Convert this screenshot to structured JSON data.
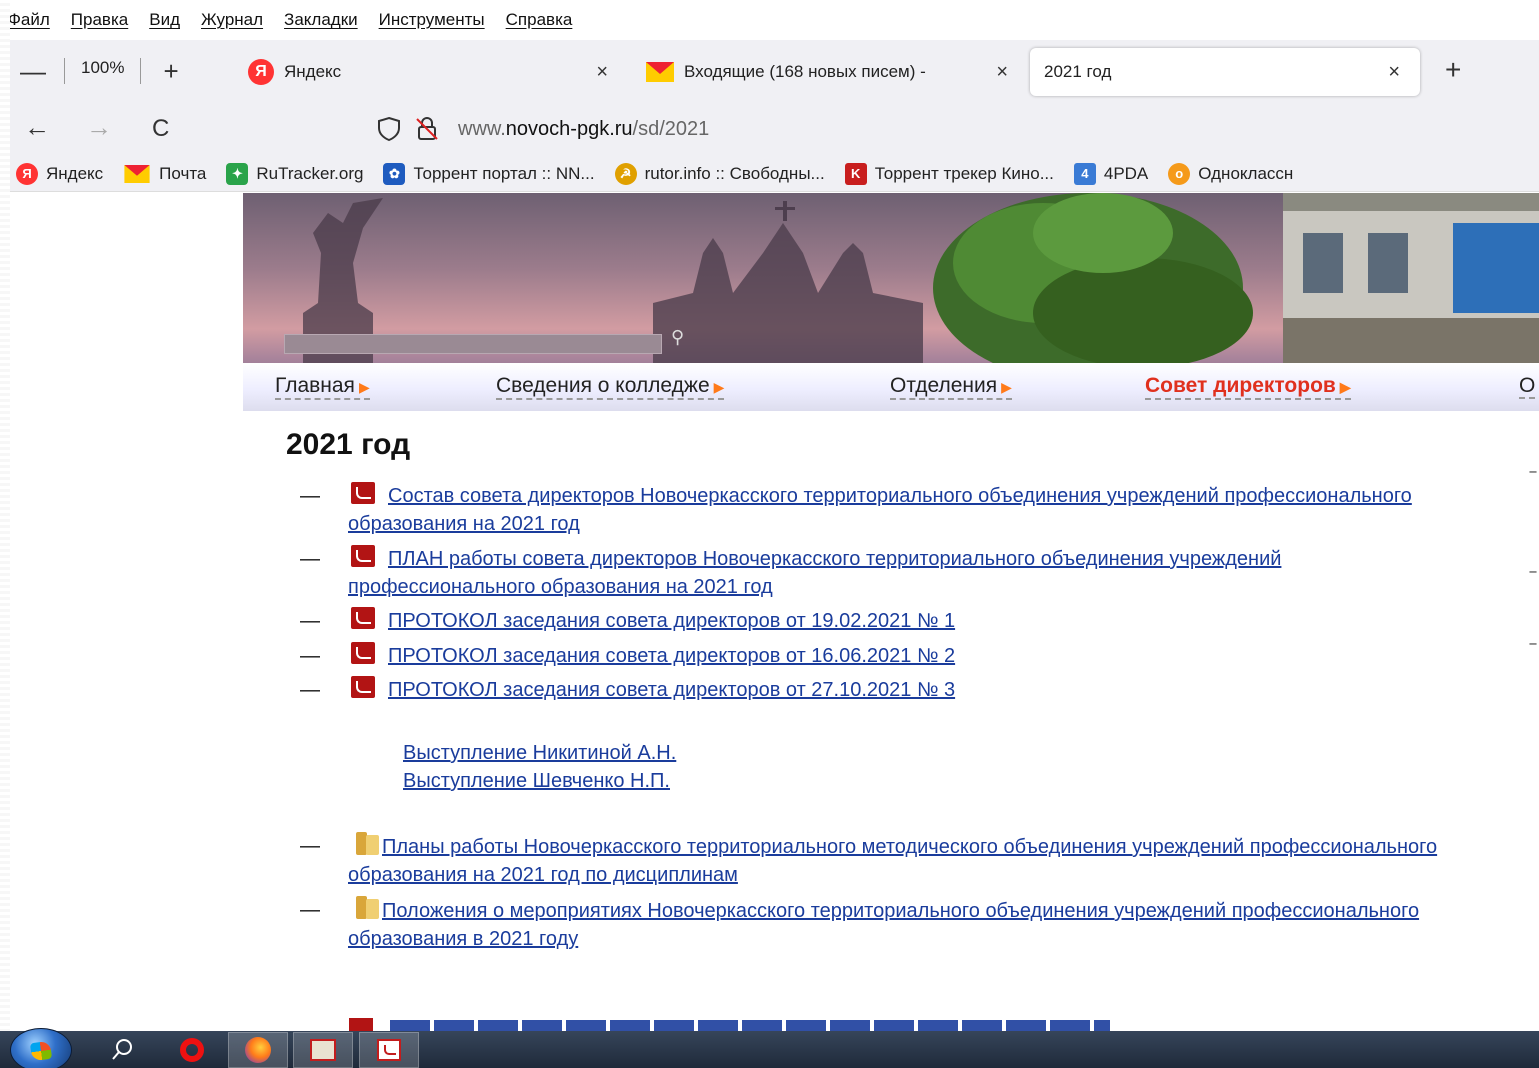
{
  "menubar": {
    "items": [
      "Файл",
      "Правка",
      "Вид",
      "Журнал",
      "Закладки",
      "Инструменты",
      "Справка"
    ]
  },
  "tabbar": {
    "zoom_minus": "—",
    "zoom_level": "100%",
    "zoom_plus": "+",
    "tabs": [
      {
        "label": "Яндекс",
        "icon": "yandex-icon"
      },
      {
        "label": "Входящие (168 новых писем) -",
        "icon": "mail-icon"
      },
      {
        "label": "2021 год",
        "icon": ""
      }
    ],
    "close_glyph": "×",
    "new_tab_glyph": "+"
  },
  "navbar": {
    "back": "←",
    "forward": "→",
    "reload": "C",
    "url_prefix": "www.",
    "url_domain": "novoch-pgk.ru",
    "url_path": "/sd/2021"
  },
  "bookmarks": [
    {
      "label": "Яндекс",
      "icon": "yandex-icon",
      "color": "#ff3333",
      "glyph": "Я"
    },
    {
      "label": "Почта",
      "icon": "mail-icon",
      "color": "#ffcc00",
      "glyph": ""
    },
    {
      "label": "RuTracker.org",
      "icon": "rutracker-icon",
      "color": "#2aa34a",
      "glyph": "✦"
    },
    {
      "label": "Торрент портал :: NN...",
      "icon": "butterfly-icon",
      "color": "#1e5bbf",
      "glyph": "✿"
    },
    {
      "label": "rutor.info :: Свободны...",
      "icon": "rutor-icon",
      "color": "#e0a000",
      "glyph": "☭"
    },
    {
      "label": "Торрент трекер Кино...",
      "icon": "kinozal-icon",
      "color": "#c81e1e",
      "glyph": "K"
    },
    {
      "label": "4PDA",
      "icon": "4pda-icon",
      "color": "#3a7bd5",
      "glyph": "4"
    },
    {
      "label": "Одноклассн",
      "icon": "ok-icon",
      "color": "#f59a1a",
      "glyph": "о"
    }
  ],
  "site": {
    "menu": [
      {
        "label": "Главная",
        "active": false
      },
      {
        "label": "Сведения о колледже",
        "active": false
      },
      {
        "label": "Отделения",
        "active": false
      },
      {
        "label": "Совет директоров",
        "active": true
      },
      {
        "label": "О",
        "active": false
      }
    ],
    "arrow": "▶",
    "search_glyph": "⚲",
    "title": "2021 год",
    "documents": [
      {
        "type": "pdf",
        "text": "Состав совета директоров Новочеркасского территориального объединения учреждений профессионального образования на 2021 год"
      },
      {
        "type": "pdf",
        "text": "ПЛАН работы совета директоров Новочеркасского территориального объединения учреждений профессионального образования на 2021 год"
      },
      {
        "type": "pdf",
        "text": "ПРОТОКОЛ заседания совета директоров от 19.02.2021 № 1"
      },
      {
        "type": "pdf",
        "text": "ПРОТОКОЛ заседания совета директоров от 16.06.2021 № 2"
      },
      {
        "type": "pdf",
        "text": "ПРОТОКОЛ заседания совета директоров от 27.10.2021 № 3"
      }
    ],
    "speeches": [
      "Выступление Никитиной А.Н.",
      "Выступление Шевченко Н.П."
    ],
    "folders": [
      {
        "type": "folder",
        "text": "Планы работы Новочеркасского территориального методического объединения учреждений профессионального образования на 2021 год по дисциплинам"
      },
      {
        "type": "folder",
        "text": "Положения о мероприятиях Новочеркасского территориального объединения учреждений профессионального образования в 2021 году"
      }
    ],
    "dash": "—"
  }
}
